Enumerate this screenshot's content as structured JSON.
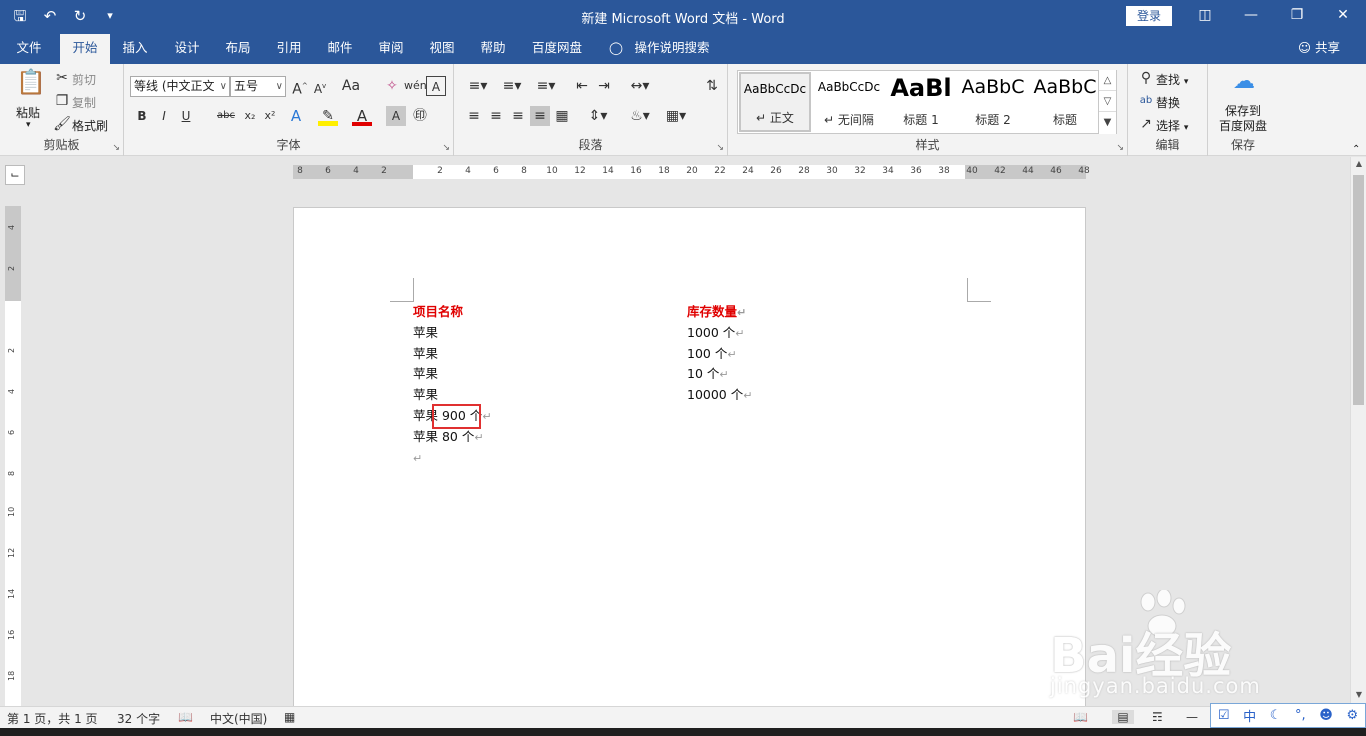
{
  "titlebar": {
    "title": "新建 Microsoft Word 文档  -  Word",
    "login_label": "登录",
    "quick_access": [
      "save-icon",
      "undo-icon",
      "redo-icon",
      "customize-icon"
    ]
  },
  "tabs": [
    {
      "label": "文件"
    },
    {
      "label": "开始",
      "active": true
    },
    {
      "label": "插入"
    },
    {
      "label": "设计"
    },
    {
      "label": "布局"
    },
    {
      "label": "引用"
    },
    {
      "label": "邮件"
    },
    {
      "label": "审阅"
    },
    {
      "label": "视图"
    },
    {
      "label": "帮助"
    },
    {
      "label": "百度网盘"
    },
    {
      "label": "操作说明搜索"
    }
  ],
  "share_label": "共享",
  "clipboard": {
    "paste": "粘贴",
    "cut": "剪切",
    "copy": "复制",
    "format_painter": "格式刷",
    "label": "剪贴板"
  },
  "font": {
    "name": "等线 (中文正文)",
    "size": "五号",
    "label": "字体",
    "name_display": "等线 (中文正文",
    "grow": "A",
    "shrink": "A",
    "case": "Aa",
    "bold": "B",
    "italic": "I",
    "underline": "U",
    "strike": "abc",
    "sub": "x₂",
    "sup": "x²"
  },
  "paragraph": {
    "label": "段落"
  },
  "styles": {
    "label": "样式",
    "items": [
      {
        "sample": "AaBbCcDc",
        "name": "正文",
        "selected": true
      },
      {
        "sample": "AaBbCcDc",
        "name": "无间隔"
      },
      {
        "sample": "AaBl",
        "name": "标题 1"
      },
      {
        "sample": "AaBbC",
        "name": "标题 2"
      },
      {
        "sample": "AaBbC",
        "name": "标题"
      }
    ]
  },
  "editing": {
    "find": "查找",
    "replace": "替换",
    "select": "选择",
    "label": "编辑"
  },
  "save_group": {
    "button": "保存到\n百度网盘",
    "line1": "保存到",
    "line2": "百度网盘",
    "label": "保存"
  },
  "ruler": {
    "h_labels": [
      "8",
      "6",
      "4",
      "2",
      "",
      "2",
      "4",
      "6",
      "8",
      "10",
      "12",
      "14",
      "16",
      "18",
      "20",
      "22",
      "24",
      "26",
      "28",
      "30",
      "32",
      "34",
      "36",
      "38",
      "40",
      "42",
      "44",
      "46",
      "48"
    ],
    "v_labels": [
      "4",
      "2",
      "",
      "2",
      "4",
      "6",
      "8",
      "10",
      "12",
      "14",
      "16",
      "18"
    ]
  },
  "document": {
    "col1_header": "项目名称",
    "col2_header": "库存数量",
    "col1": [
      "苹果",
      "苹果",
      "苹果",
      "苹果",
      "苹果 900 个",
      "苹果 80 个"
    ],
    "col2": [
      "1000 个",
      "100 个",
      "10 个",
      "10000 个"
    ],
    "return_mark": "↵"
  },
  "status": {
    "page": "第 1 页，共 1 页",
    "words": "32 个字",
    "language": "中文(中国)"
  },
  "ime": {
    "mode": "中"
  },
  "watermark": {
    "text": "Bai经验",
    "url": "jingyan.baidu.com"
  }
}
